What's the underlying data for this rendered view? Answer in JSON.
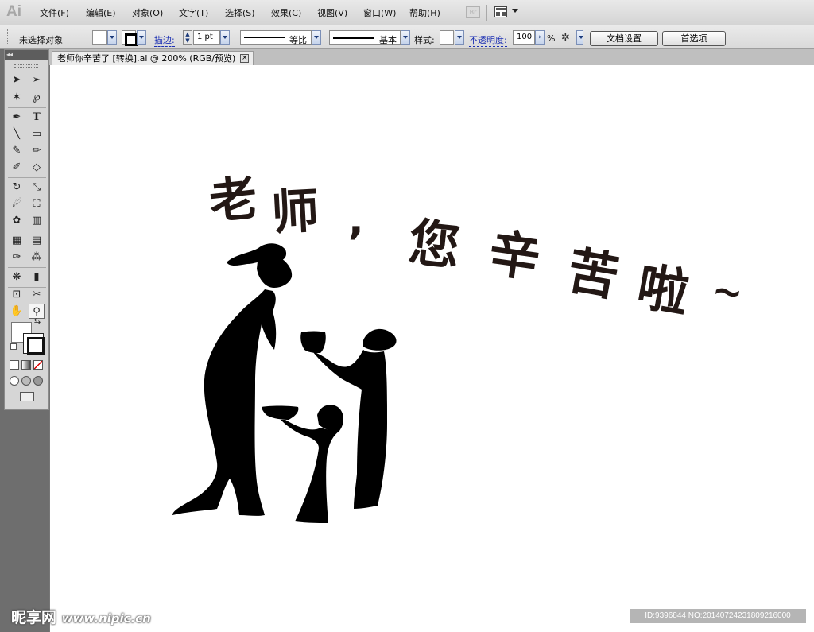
{
  "app": {
    "logo": "Ai"
  },
  "menu": [
    "文件(F)",
    "编辑(E)",
    "对象(O)",
    "文字(T)",
    "选择(S)",
    "效果(C)",
    "视图(V)",
    "窗口(W)",
    "帮助(H)"
  ],
  "menu_icons": {
    "bridge": "Br",
    "arrange": "arrange-documents-icon"
  },
  "control_bar": {
    "selection_status": "未选择对象",
    "stroke_label": "描边:",
    "stroke_weight": "1 pt",
    "profile_label": "等比",
    "brush_label": "基本",
    "style_label": "样式:",
    "opacity_label": "不透明度:",
    "opacity_value": "100",
    "opacity_unit": "%",
    "doc_setup_button": "文档设置",
    "preferences_button": "首选项"
  },
  "toolbox": {
    "collapse": "◂◂",
    "tools": [
      "selection",
      "direct-selection",
      "magic-wand",
      "lasso",
      "pen",
      "type",
      "line-segment",
      "rectangle",
      "paintbrush",
      "pencil",
      "blob-brush",
      "eraser",
      "rotate",
      "scale",
      "warp",
      "free-transform",
      "symbol-sprayer",
      "column-graph",
      "mesh",
      "gradient",
      "eyedropper",
      "blend",
      "live-paint-bucket",
      "live-paint-selection",
      "artboard",
      "slice",
      "hand",
      "zoom"
    ]
  },
  "document": {
    "tab_title": "老师你辛苦了 [转换].ai @ 200% (RGB/预览)",
    "close_glyph": "×"
  },
  "artwork": {
    "headline": [
      "老",
      "师",
      ",",
      "您",
      "辛",
      "苦",
      "啦",
      "~"
    ],
    "fill_color": "#000000",
    "text_color": "#231815"
  },
  "watermark": {
    "brand": "昵享网",
    "url": "www.nipic.cn",
    "id_text": "ID:9396844 NO:20140724231809216000"
  }
}
